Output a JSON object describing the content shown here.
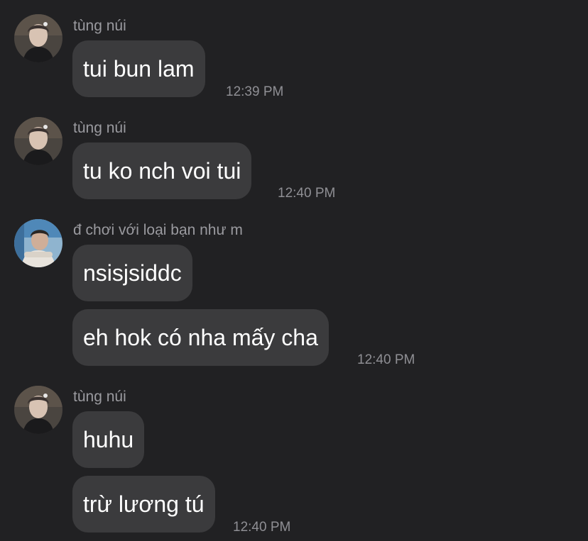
{
  "messages": [
    {
      "sender": "tùng núi",
      "avatar": "avatar-tung-nui",
      "bubbles": [
        "tui bun lam"
      ],
      "time": "12:39 PM"
    },
    {
      "sender": "tùng núi",
      "avatar": "avatar-tung-nui",
      "bubbles": [
        "tu ko nch voi tui"
      ],
      "time": "12:40 PM"
    },
    {
      "sender": "đ chơi với loại bạn như m",
      "avatar": "avatar-friend",
      "bubbles": [
        "nsisjsiddc",
        "eh hok có nha mấy cha"
      ],
      "time": "12:40 PM"
    },
    {
      "sender": "tùng núi",
      "avatar": "avatar-tung-nui",
      "bubbles": [
        "huhu",
        "trừ lương tú"
      ],
      "time": "12:40 PM"
    }
  ],
  "colors": {
    "background": "#212123",
    "bubble": "#3b3b3d",
    "sender_text": "#9a9a9f",
    "time_text": "#8f8f94",
    "message_text": "#ffffff"
  }
}
